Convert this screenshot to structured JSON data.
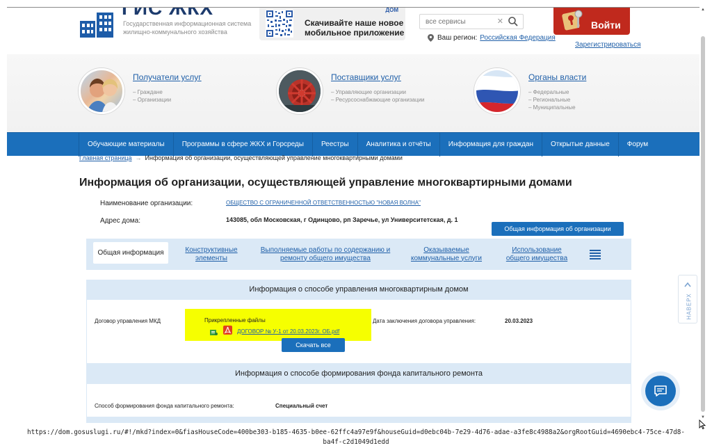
{
  "header": {
    "logo_title": "ГИС ЖКХ",
    "logo_subtitle": "Государственная информационная система жилищно-коммунального хозяйства",
    "app_banner": {
      "text_line1": "Скачивайте наше новое",
      "text_line2": "мобильное приложение",
      "tag": "ДОМ"
    },
    "search": {
      "placeholder": "все сервисы"
    },
    "region": {
      "label": "Ваш регион:",
      "value": "Российская Федерация"
    },
    "login_label": "Войти",
    "register_label": "Зарегистрироваться"
  },
  "hero": [
    {
      "title": "Получатели услуг",
      "items": [
        "– Граждане",
        "– Организации"
      ]
    },
    {
      "title": "Поставщики услуг",
      "items": [
        "– Управляющие организации",
        "– Ресурсоснабжающие организации"
      ]
    },
    {
      "title": "Органы власти",
      "items": [
        "– Федеральные",
        "– Региональные",
        "– Муниципальные"
      ]
    }
  ],
  "nav": [
    "Обучающие материалы",
    "Программы в сфере ЖКХ и Горсреды",
    "Реестры",
    "Аналитика и отчёты",
    "Информация для граждан",
    "Открытые данные",
    "Форум"
  ],
  "breadcrumb": {
    "home": "Главная страница",
    "arrow": "→",
    "current": "Информация об организации, осуществляющей управление многоквартирными домами"
  },
  "page_title": "Информация об организации, осуществляющей управление многоквартирными домами",
  "org": {
    "name_label": "Наименование организации:",
    "name_value": "ОБЩЕСТВО С ОГРАНИЧЕННОЙ ОТВЕТСТВЕННОСТЬЮ \"НОВАЯ ВОЛНА\"",
    "address_label": "Адрес дома:",
    "address_value": "143085, обл Московская, г Одинцово, рп Заречье, ул Университетская, д. 1",
    "general_button": "Общая информация об организации"
  },
  "tabs": [
    {
      "line1": "Общая информация",
      "line2": ""
    },
    {
      "line1": "Конструктивные",
      "line2": "элементы"
    },
    {
      "line1": "Выполняемые работы по содержанию и",
      "line2": "ремонту общего имущества"
    },
    {
      "line1": "Оказываемые",
      "line2": "коммунальные услуги"
    },
    {
      "line1": "Использование",
      "line2": "общего имущества"
    }
  ],
  "section_management": {
    "title": "Информация о способе управления многоквартирным домом",
    "contract_label": "Договор управления МКД",
    "files_title": "Прикрепленные файлы",
    "file_name": "ДОГОВОР № У-1 от 20.03.2023г. ОБ.pdf",
    "date_label": "Дата заключения договора управления:",
    "date_value": "20.03.2023",
    "download_all": "Скачать все"
  },
  "section_fund": {
    "title": "Информация о способе формирования фонда капитального ремонта",
    "label": "Способ формирования фонда капитального ремонта:",
    "value": "Специальный счет"
  },
  "scroll_top_label": "НАВЕРХ",
  "status_url_line1": "https://dom.gosuslugi.ru/#!/mkd?index=0&fiasHouseCode=400be303-b185-4635-b0ee-62ffc4a97e9f&houseGuid=d0ebc04b-7e29-4d76-adae-a3fe8c4988a2&orgRootGuid=4690ebc4-75ce-47d8-",
  "status_url_line2": "ba4f-c2d1049d1edd"
}
